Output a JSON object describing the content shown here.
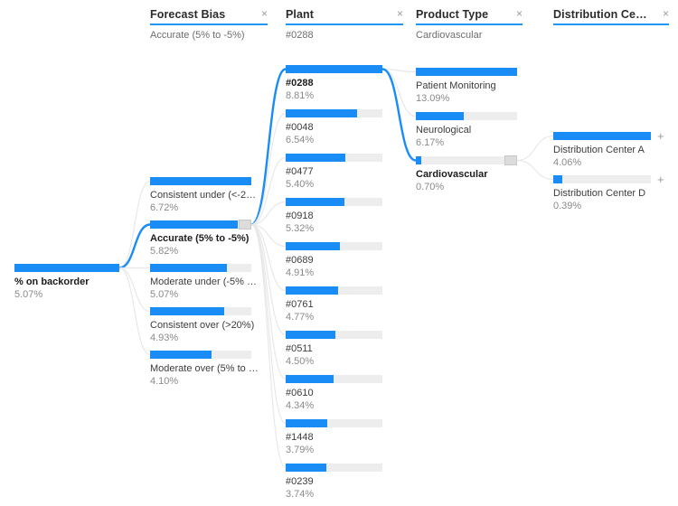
{
  "columns": [
    {
      "key": "forecast_bias",
      "title": "Forecast Bias",
      "subtitle": "Accurate (5% to -5%)",
      "close_label": "×"
    },
    {
      "key": "plant",
      "title": "Plant",
      "subtitle": "#0288",
      "close_label": "×"
    },
    {
      "key": "product_type",
      "title": "Product Type",
      "subtitle": "Cardiovascular",
      "close_label": "×"
    },
    {
      "key": "distribution_center",
      "title": "Distribution Cent…",
      "subtitle": "",
      "close_label": "×"
    }
  ],
  "root": {
    "label": "% on backorder",
    "value": "5.07%",
    "pct": 5.07,
    "selected": true,
    "fill_ratio": 1.0
  },
  "forecast_bias_nodes": [
    {
      "label": "Consistent under (<-2…",
      "value": "6.72%",
      "pct": 6.72,
      "fill_ratio": 1.0,
      "selected": false
    },
    {
      "label": "Accurate (5% to -5%)",
      "value": "5.82%",
      "pct": 5.82,
      "fill_ratio": 0.866,
      "selected": true
    },
    {
      "label": "Moderate under (-5% …",
      "value": "5.07%",
      "pct": 5.07,
      "fill_ratio": 0.755,
      "selected": false
    },
    {
      "label": "Consistent over (>20%)",
      "value": "4.93%",
      "pct": 4.93,
      "fill_ratio": 0.734,
      "selected": false
    },
    {
      "label": "Moderate over (5% to …",
      "value": "4.10%",
      "pct": 4.1,
      "fill_ratio": 0.61,
      "selected": false
    }
  ],
  "plant_nodes": [
    {
      "label": "#0288",
      "value": "8.81%",
      "pct": 8.81,
      "fill_ratio": 1.0,
      "selected": true
    },
    {
      "label": "#0048",
      "value": "6.54%",
      "pct": 6.54,
      "fill_ratio": 0.742,
      "selected": false
    },
    {
      "label": "#0477",
      "value": "5.40%",
      "pct": 5.4,
      "fill_ratio": 0.613,
      "selected": false
    },
    {
      "label": "#0918",
      "value": "5.32%",
      "pct": 5.32,
      "fill_ratio": 0.604,
      "selected": false
    },
    {
      "label": "#0689",
      "value": "4.91%",
      "pct": 4.91,
      "fill_ratio": 0.557,
      "selected": false
    },
    {
      "label": "#0761",
      "value": "4.77%",
      "pct": 4.77,
      "fill_ratio": 0.541,
      "selected": false
    },
    {
      "label": "#0511",
      "value": "4.50%",
      "pct": 4.5,
      "fill_ratio": 0.511,
      "selected": false
    },
    {
      "label": "#0610",
      "value": "4.34%",
      "pct": 4.34,
      "fill_ratio": 0.493,
      "selected": false
    },
    {
      "label": "#1448",
      "value": "3.79%",
      "pct": 3.79,
      "fill_ratio": 0.43,
      "selected": false
    },
    {
      "label": "#0239",
      "value": "3.74%",
      "pct": 3.74,
      "fill_ratio": 0.425,
      "selected": false
    }
  ],
  "product_type_nodes": [
    {
      "label": "Patient Monitoring",
      "value": "13.09%",
      "pct": 13.09,
      "fill_ratio": 1.0,
      "selected": false
    },
    {
      "label": "Neurological",
      "value": "6.17%",
      "pct": 6.17,
      "fill_ratio": 0.471,
      "selected": false
    },
    {
      "label": "Cardiovascular",
      "value": "0.70%",
      "pct": 0.7,
      "fill_ratio": 0.053,
      "selected": true
    }
  ],
  "distribution_center_nodes": [
    {
      "label": "Distribution Center A",
      "value": "4.06%",
      "pct": 4.06,
      "fill_ratio": 1.0,
      "selected": false,
      "expand_label": "+"
    },
    {
      "label": "Distribution Center D",
      "value": "0.39%",
      "pct": 0.39,
      "fill_ratio": 0.096,
      "selected": false,
      "expand_label": "+"
    }
  ],
  "colors": {
    "bar_fill": "#1a8cf5",
    "bar_track": "#ededed",
    "ribbon_highlight": "#1a8cf5",
    "ribbon_default": "#e8e8e8",
    "header_underline": "#2196f3",
    "label_text": "#3c3c3c",
    "value_text": "#8a8a8a"
  }
}
